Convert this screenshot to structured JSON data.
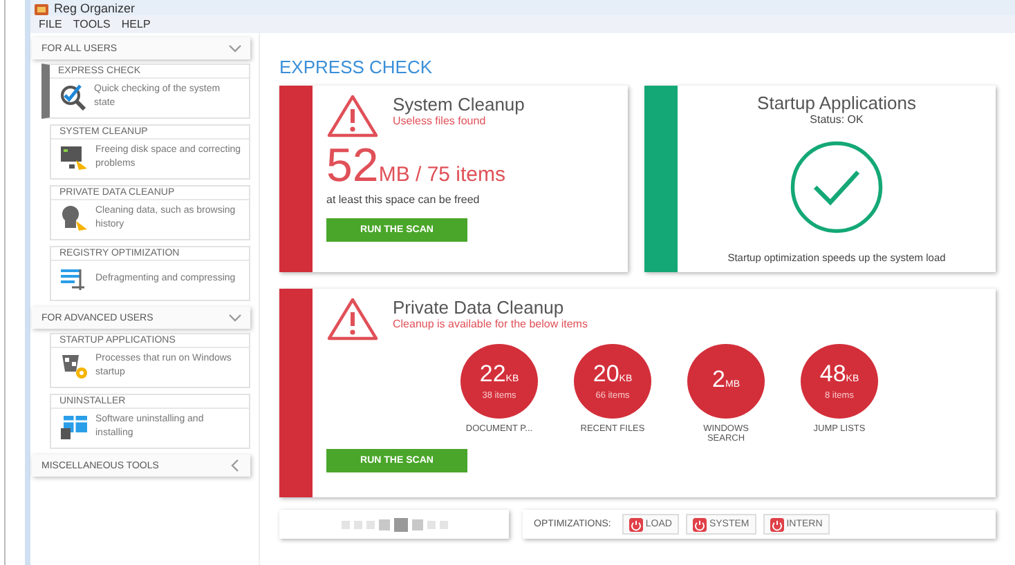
{
  "window": {
    "title": "Reg Organizer"
  },
  "menu": [
    "FILE",
    "TOOLS",
    "HELP"
  ],
  "sidebar": [
    {
      "title": "FOR ALL USERS",
      "expanded": true,
      "items": [
        {
          "title": "EXPRESS CHECK",
          "description": "Quick checking of the system state",
          "selected": true
        },
        {
          "title": "SYSTEM CLEANUP",
          "description": "Freeing disk space and correcting problems",
          "selected": false
        },
        {
          "title": "PRIVATE DATA CLEANUP",
          "description": "Cleaning data, such as browsing history",
          "selected": false
        },
        {
          "title": "REGISTRY OPTIMIZATION",
          "description": "Defragmenting and compressing",
          "selected": false
        }
      ]
    },
    {
      "title": "FOR ADVANCED USERS",
      "expanded": true,
      "items": [
        {
          "title": "STARTUP APPLICATIONS",
          "description": "Processes that run on Windows startup",
          "selected": false
        },
        {
          "title": "UNINSTALLER",
          "description": "Software uninstalling and installing",
          "selected": false
        }
      ]
    },
    {
      "title": "MISCELLANEOUS TOOLS",
      "expanded": false
    }
  ],
  "heading": "EXPRESS CHECK",
  "cards": [
    {
      "kind": "problem",
      "title": "System Cleanup",
      "subtitle": "Useless files found",
      "amount": "52",
      "unit": "MB / 75 items",
      "note": "at least this space can be freed",
      "button": "RUN THE SCAN"
    },
    {
      "kind": "ok",
      "title": "Startup Applications",
      "subtitle": "Status: OK",
      "note": "Startup optimization speeds up the system load"
    },
    {
      "kind": "list",
      "title": "Private Data Cleanup",
      "subtitle": "Cleanup is available for the below items",
      "items": [
        {
          "size": "22",
          "unit": "KB",
          "count": "38 items",
          "label": "DOCUMENT P..."
        },
        {
          "size": "20",
          "unit": "KB",
          "count": "66 items",
          "label": "RECENT FILES"
        },
        {
          "size": "2",
          "unit": "MB",
          "label": "WINDOWS SEARCH"
        },
        {
          "size": "48",
          "unit": "KB",
          "count": "8 items",
          "label": "JUMP LISTS"
        }
      ],
      "button": "RUN THE SCAN"
    }
  ],
  "pager": [
    {
      "selected": false
    },
    {
      "selected": false
    },
    {
      "selected": false
    },
    {
      "selected": false
    },
    {
      "selected": true
    },
    {
      "selected": false
    },
    {
      "selected": false
    },
    {
      "selected": false
    }
  ],
  "optimizations": {
    "label": "OPTIMIZATIONS:",
    "buttons": [
      "LOAD",
      "SYSTEM",
      "INTERN"
    ]
  }
}
